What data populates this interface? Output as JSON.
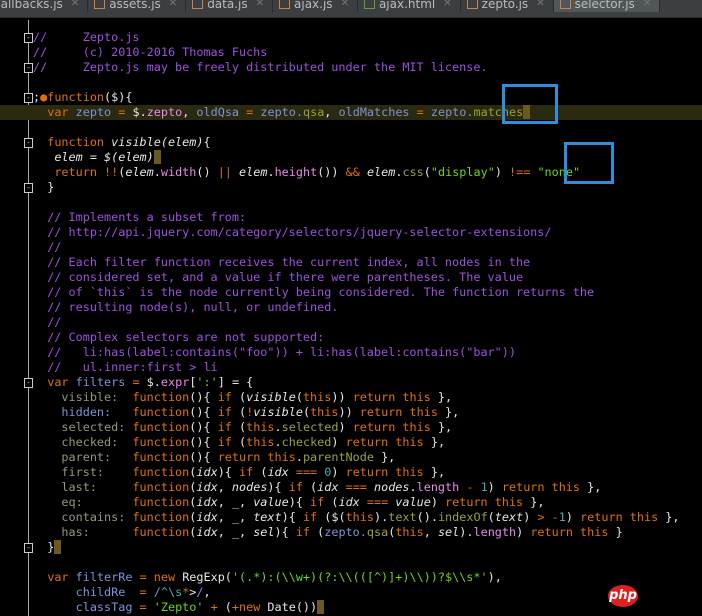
{
  "tabs": [
    {
      "label": "callbacks.js",
      "type": "js"
    },
    {
      "label": "assets.js",
      "type": "js"
    },
    {
      "label": "data.js",
      "type": "js"
    },
    {
      "label": "ajax.js",
      "type": "js"
    },
    {
      "label": "ajax.html",
      "type": "html"
    },
    {
      "label": "zepto.js",
      "type": "js"
    },
    {
      "label": "selector.js",
      "type": "js",
      "active": true
    }
  ],
  "watermark": "php",
  "lines": [
    {
      "fold": true,
      "t": [
        [
          "c",
          "//     Zepto.js"
        ]
      ]
    },
    {
      "t": [
        [
          "c",
          "//     (c) 2010-2016 Thomas Fuchs"
        ]
      ]
    },
    {
      "fold": true,
      "t": [
        [
          "c",
          "//     Zepto.js may be freely distributed under the MIT license."
        ]
      ]
    },
    {
      "t": []
    },
    {
      "fold": true,
      "t": [
        [
          "d",
          ";"
        ],
        [
          "k",
          "●function"
        ],
        [
          "d",
          "($){"
        ]
      ]
    },
    {
      "hl": true,
      "t": [
        [
          "d",
          "  "
        ],
        [
          "k",
          "var "
        ],
        [
          "v",
          "zepto"
        ],
        [
          "k",
          " = "
        ],
        [
          "d",
          "$."
        ],
        [
          "p",
          "zepto"
        ],
        [
          "d",
          ", "
        ],
        [
          "v",
          "oldQsa"
        ],
        [
          "k",
          " = "
        ],
        [
          "v",
          "zepto."
        ],
        [
          "f",
          "qsa"
        ],
        [
          "d",
          ", "
        ],
        [
          "v",
          "oldMatches"
        ],
        [
          "k",
          " = "
        ],
        [
          "v",
          "zepto."
        ],
        [
          "f",
          "matches"
        ],
        [
          "cur",
          " "
        ]
      ]
    },
    {
      "t": []
    },
    {
      "fold": true,
      "t": [
        [
          "d",
          "  "
        ],
        [
          "k",
          "function "
        ],
        [
          "i",
          "visible(elem)"
        ],
        [
          "d",
          "{"
        ]
      ]
    },
    {
      "t": [
        [
          "d",
          "   "
        ],
        [
          "i",
          "elem"
        ],
        [
          "d",
          " = "
        ],
        [
          "i",
          "$(elem)"
        ],
        [
          "cur",
          " "
        ]
      ]
    },
    {
      "t": [
        [
          "d",
          "   "
        ],
        [
          "k",
          "return !!"
        ],
        [
          "d",
          "("
        ],
        [
          "i",
          "elem"
        ],
        [
          "d",
          "."
        ],
        [
          "p",
          "width"
        ],
        [
          "d",
          "() "
        ],
        [
          "k",
          "||"
        ],
        [
          "d",
          " "
        ],
        [
          "i",
          "elem"
        ],
        [
          "d",
          "."
        ],
        [
          "p",
          "height"
        ],
        [
          "d",
          "()) "
        ],
        [
          "k",
          "&&"
        ],
        [
          "d",
          " "
        ],
        [
          "i",
          "elem"
        ],
        [
          "d",
          "."
        ],
        [
          "f",
          "css"
        ],
        [
          "d",
          "("
        ],
        [
          "s",
          "\"display\""
        ],
        [
          "d",
          ") "
        ],
        [
          "k",
          "!=="
        ],
        [
          "d",
          " "
        ],
        [
          "s",
          "\"none\""
        ]
      ]
    },
    {
      "fold": true,
      "t": [
        [
          "d",
          "  }"
        ]
      ]
    },
    {
      "t": []
    },
    {
      "t": [
        [
          "c",
          "  // Implements a subset from:"
        ]
      ]
    },
    {
      "t": [
        [
          "c",
          "  // http://api.jquery.com/category/selectors/jquery-selector-extensions/"
        ]
      ]
    },
    {
      "t": [
        [
          "c",
          "  //"
        ]
      ]
    },
    {
      "t": [
        [
          "c",
          "  // Each filter function receives the current index, all nodes in the"
        ]
      ]
    },
    {
      "t": [
        [
          "c",
          "  // considered set, and a value if there were parentheses. The value"
        ]
      ]
    },
    {
      "t": [
        [
          "c",
          "  // of `this` is the node currently being considered. The function returns the"
        ]
      ]
    },
    {
      "t": [
        [
          "c",
          "  // resulting node(s), null, or undefined."
        ]
      ]
    },
    {
      "t": [
        [
          "c",
          "  //"
        ]
      ]
    },
    {
      "t": [
        [
          "c",
          "  // Complex selectors are not supported:"
        ]
      ]
    },
    {
      "t": [
        [
          "c",
          "  //   li:has(label:contains(\"foo\")) + li:has(label:contains(\"bar\"))"
        ]
      ]
    },
    {
      "t": [
        [
          "c",
          "  //   ul.inner:first > li"
        ]
      ]
    },
    {
      "fold": true,
      "t": [
        [
          "d",
          "  "
        ],
        [
          "k",
          "var "
        ],
        [
          "v",
          "filters"
        ],
        [
          "k",
          " = "
        ],
        [
          "d",
          "$."
        ],
        [
          "p",
          "expr"
        ],
        [
          "d",
          "["
        ],
        [
          "s",
          "':'"
        ],
        [
          "d",
          "] = {"
        ]
      ]
    },
    {
      "t": [
        [
          "o",
          "    visible:  "
        ],
        [
          "k",
          "function"
        ],
        [
          "d",
          "(){ "
        ],
        [
          "k",
          "if"
        ],
        [
          "d",
          " ("
        ],
        [
          "i",
          "visible"
        ],
        [
          "d",
          "("
        ],
        [
          "k",
          "this"
        ],
        [
          "d",
          ")) "
        ],
        [
          "k",
          "return this"
        ],
        [
          "d",
          " },"
        ]
      ]
    },
    {
      "t": [
        [
          "v",
          "    hidden:   "
        ],
        [
          "k",
          "function"
        ],
        [
          "d",
          "(){ "
        ],
        [
          "k",
          "if"
        ],
        [
          "d",
          " ("
        ],
        [
          "k",
          "!"
        ],
        [
          "i",
          "visible"
        ],
        [
          "d",
          "("
        ],
        [
          "k",
          "this"
        ],
        [
          "d",
          ")) "
        ],
        [
          "k",
          "return this"
        ],
        [
          "d",
          " },"
        ]
      ]
    },
    {
      "t": [
        [
          "o",
          "    selected: "
        ],
        [
          "k",
          "function"
        ],
        [
          "d",
          "(){ "
        ],
        [
          "k",
          "if"
        ],
        [
          "d",
          " ("
        ],
        [
          "k",
          "this"
        ],
        [
          "d",
          "."
        ],
        [
          "f",
          "selected"
        ],
        [
          "d",
          ") "
        ],
        [
          "k",
          "return this"
        ],
        [
          "d",
          " },"
        ]
      ]
    },
    {
      "t": [
        [
          "o",
          "    checked:  "
        ],
        [
          "k",
          "function"
        ],
        [
          "d",
          "(){ "
        ],
        [
          "k",
          "if"
        ],
        [
          "d",
          " ("
        ],
        [
          "k",
          "this"
        ],
        [
          "d",
          "."
        ],
        [
          "f",
          "checked"
        ],
        [
          "d",
          ") "
        ],
        [
          "k",
          "return this"
        ],
        [
          "d",
          " },"
        ]
      ]
    },
    {
      "t": [
        [
          "o",
          "    parent:   "
        ],
        [
          "k",
          "function"
        ],
        [
          "d",
          "(){ "
        ],
        [
          "k",
          "return this"
        ],
        [
          "d",
          "."
        ],
        [
          "f",
          "parentNode"
        ],
        [
          "d",
          " },"
        ]
      ]
    },
    {
      "t": [
        [
          "o",
          "    first:    "
        ],
        [
          "k",
          "function"
        ],
        [
          "d",
          "("
        ],
        [
          "i",
          "idx"
        ],
        [
          "d",
          "){ "
        ],
        [
          "k",
          "if"
        ],
        [
          "d",
          " ("
        ],
        [
          "i",
          "idx"
        ],
        [
          "k",
          " === "
        ],
        [
          "n",
          "0"
        ],
        [
          "d",
          ") "
        ],
        [
          "k",
          "return this"
        ],
        [
          "d",
          " },"
        ]
      ]
    },
    {
      "t": [
        [
          "o",
          "    last:     "
        ],
        [
          "k",
          "function"
        ],
        [
          "d",
          "("
        ],
        [
          "i",
          "idx"
        ],
        [
          "d",
          ", "
        ],
        [
          "i",
          "nodes"
        ],
        [
          "d",
          "){ "
        ],
        [
          "k",
          "if"
        ],
        [
          "d",
          " ("
        ],
        [
          "i",
          "idx"
        ],
        [
          "k",
          " === "
        ],
        [
          "i",
          "nodes"
        ],
        [
          "d",
          "."
        ],
        [
          "p",
          "length"
        ],
        [
          "k",
          " - "
        ],
        [
          "n",
          "1"
        ],
        [
          "d",
          ") "
        ],
        [
          "k",
          "return this"
        ],
        [
          "d",
          " },"
        ]
      ]
    },
    {
      "t": [
        [
          "o",
          "    eq:       "
        ],
        [
          "k",
          "function"
        ],
        [
          "d",
          "("
        ],
        [
          "i",
          "idx"
        ],
        [
          "d",
          ", _, "
        ],
        [
          "i",
          "value"
        ],
        [
          "d",
          "){ "
        ],
        [
          "k",
          "if"
        ],
        [
          "d",
          " ("
        ],
        [
          "i",
          "idx"
        ],
        [
          "k",
          " === "
        ],
        [
          "i",
          "value"
        ],
        [
          "d",
          ") "
        ],
        [
          "k",
          "return this"
        ],
        [
          "d",
          " },"
        ]
      ]
    },
    {
      "t": [
        [
          "o",
          "    contains: "
        ],
        [
          "k",
          "function"
        ],
        [
          "d",
          "("
        ],
        [
          "i",
          "idx"
        ],
        [
          "d",
          ", _, "
        ],
        [
          "i",
          "text"
        ],
        [
          "d",
          "){ "
        ],
        [
          "k",
          "if"
        ],
        [
          "d",
          " ($("
        ],
        [
          "k",
          "this"
        ],
        [
          "d",
          ")."
        ],
        [
          "f",
          "text"
        ],
        [
          "d",
          "()."
        ],
        [
          "f",
          "indexOf"
        ],
        [
          "d",
          "("
        ],
        [
          "i",
          "text"
        ],
        [
          "d",
          ") "
        ],
        [
          "k",
          "> -"
        ],
        [
          "n",
          "1"
        ],
        [
          "d",
          ") "
        ],
        [
          "k",
          "return this"
        ],
        [
          "d",
          " },"
        ]
      ]
    },
    {
      "t": [
        [
          "o",
          "    has:      "
        ],
        [
          "k",
          "function"
        ],
        [
          "d",
          "("
        ],
        [
          "i",
          "idx"
        ],
        [
          "d",
          ", _, "
        ],
        [
          "i",
          "sel"
        ],
        [
          "d",
          "){ "
        ],
        [
          "k",
          "if"
        ],
        [
          "d",
          " ("
        ],
        [
          "v",
          "zepto."
        ],
        [
          "f",
          "qsa"
        ],
        [
          "d",
          "("
        ],
        [
          "k",
          "this"
        ],
        [
          "d",
          ", "
        ],
        [
          "i",
          "sel"
        ],
        [
          "d",
          ")."
        ],
        [
          "p",
          "length"
        ],
        [
          "d",
          ") "
        ],
        [
          "k",
          "return this"
        ],
        [
          "d",
          " }"
        ]
      ]
    },
    {
      "fold": true,
      "t": [
        [
          "d",
          "  }"
        ],
        [
          "cur",
          " "
        ]
      ]
    },
    {
      "t": []
    },
    {
      "t": [
        [
          "d",
          "  "
        ],
        [
          "k",
          "var "
        ],
        [
          "v",
          "filterRe"
        ],
        [
          "k",
          " = new "
        ],
        [
          "d",
          "RegExp("
        ],
        [
          "s",
          "'(.*):(\\\\w+)(?:\\\\(([^)]+)\\\\))?$\\\\s*'"
        ],
        [
          "d",
          "),"
        ]
      ]
    },
    {
      "t": [
        [
          "v",
          "      childRe  "
        ],
        [
          "k",
          "= "
        ],
        [
          "v",
          "/"
        ],
        [
          "n",
          "^\\s"
        ],
        [
          "k",
          "*"
        ],
        [
          "d",
          ">"
        ],
        [
          "v",
          "/"
        ],
        [
          "d",
          ","
        ]
      ]
    },
    {
      "t": [
        [
          "v",
          "      classTag "
        ],
        [
          "k",
          "= "
        ],
        [
          "s",
          "'Zepto'"
        ],
        [
          "k",
          " + "
        ],
        [
          "d",
          "("
        ],
        [
          "k",
          "+new "
        ],
        [
          "d",
          "Date())"
        ],
        [
          "cur",
          " "
        ]
      ]
    }
  ]
}
